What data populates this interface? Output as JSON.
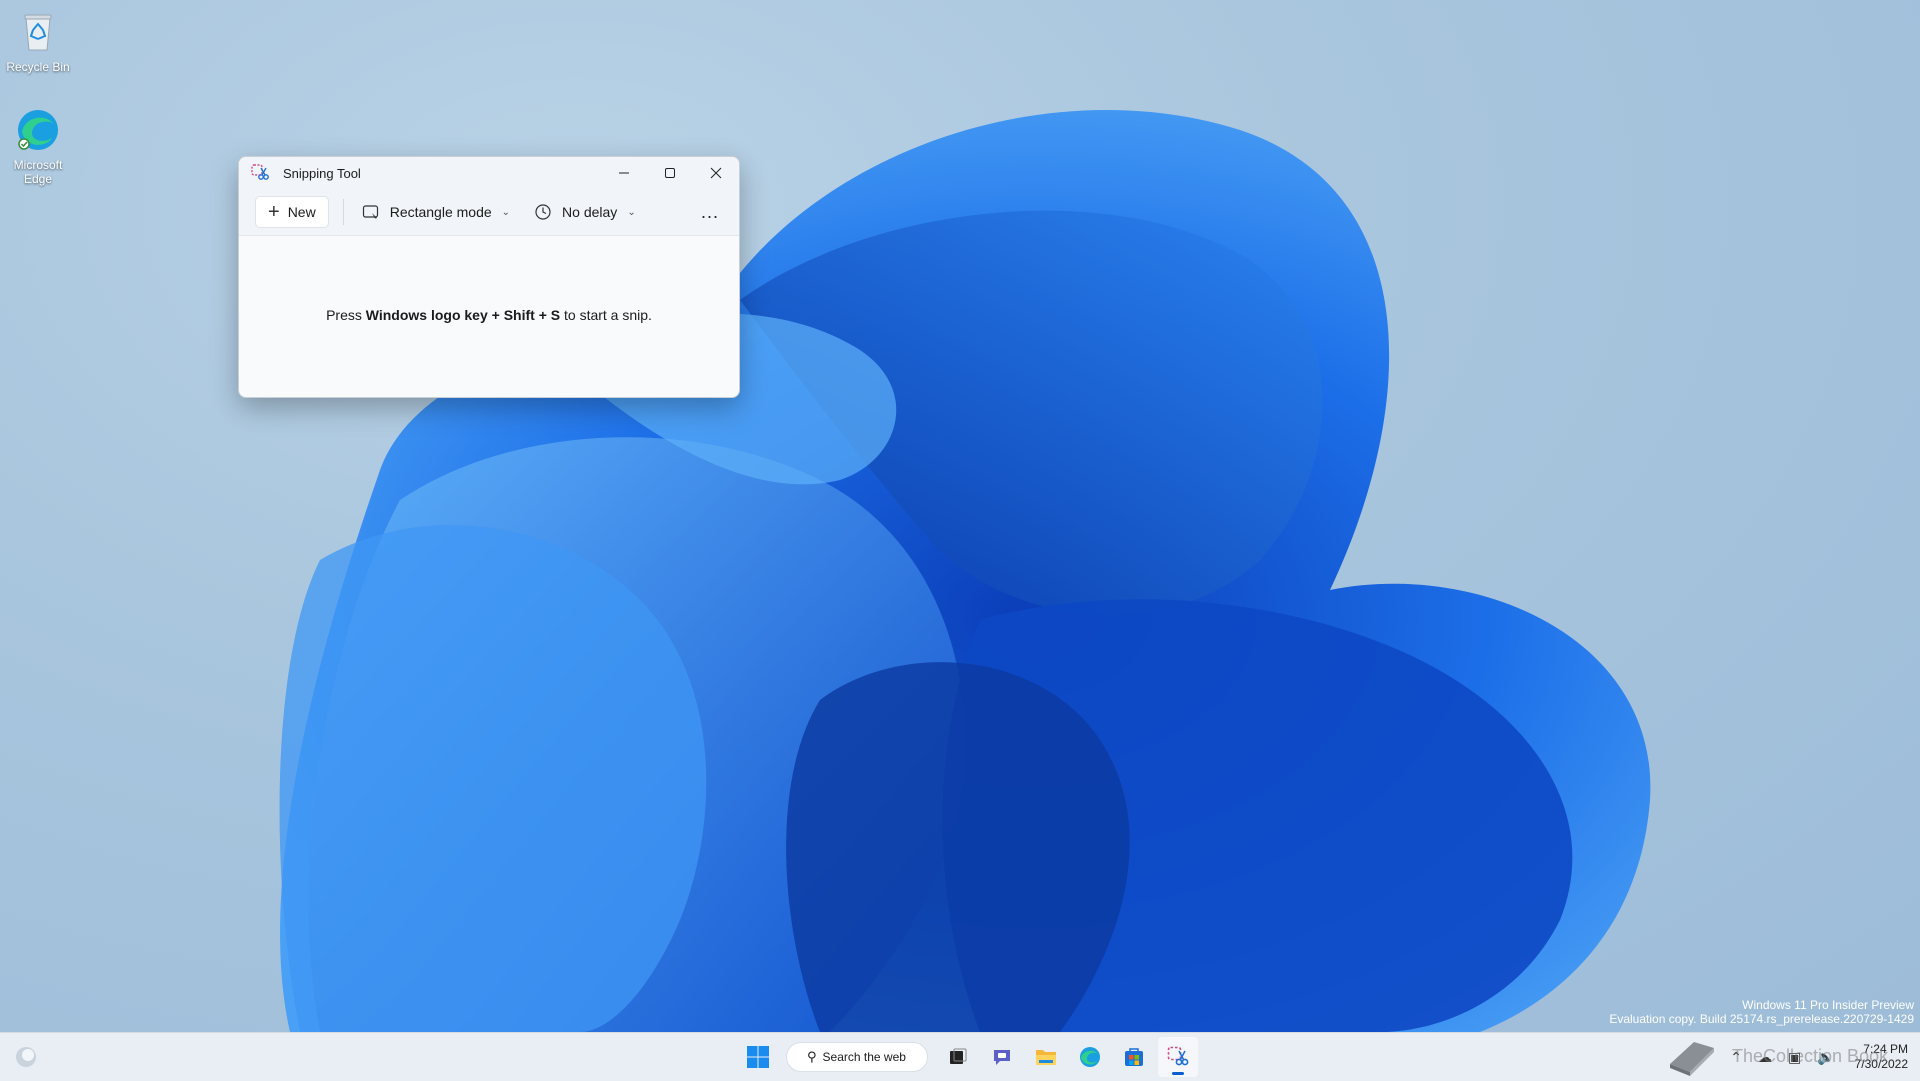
{
  "desktop": {
    "icons": [
      {
        "label": "Recycle Bin"
      },
      {
        "label": "Microsoft Edge"
      }
    ],
    "watermark": {
      "line1": "Windows 11 Pro Insider Preview",
      "line2": "Evaluation copy. Build 25174.rs_prerelease.220729-1429"
    }
  },
  "window": {
    "title": "Snipping Tool",
    "controls": {
      "minimize": "minimize-icon",
      "maximize": "maximize-icon",
      "close": "close-icon"
    },
    "toolbar": {
      "new_label": "New",
      "mode_label": "Rectangle mode",
      "delay_label": "No delay",
      "more_label": "..."
    },
    "hint": {
      "prefix": "Press ",
      "keys": "Windows logo key + Shift + S",
      "suffix": " to start a snip."
    }
  },
  "taskbar": {
    "search_label": "Search the web",
    "apps": [
      "start-icon",
      "search",
      "task-view-icon",
      "teams-chat-icon",
      "file-explorer-icon",
      "edge-icon",
      "store-icon",
      "snipping-tool-icon"
    ],
    "active_app": "snipping-tool-icon",
    "clock": {
      "time": "7:24 PM",
      "date": "7/30/2022"
    },
    "overlay_text": "TheCollection Book"
  },
  "colors": {
    "accent": "#0a5fd0",
    "bloom_blue": "#1f6fe6",
    "window_bg": "#f8fafc"
  }
}
